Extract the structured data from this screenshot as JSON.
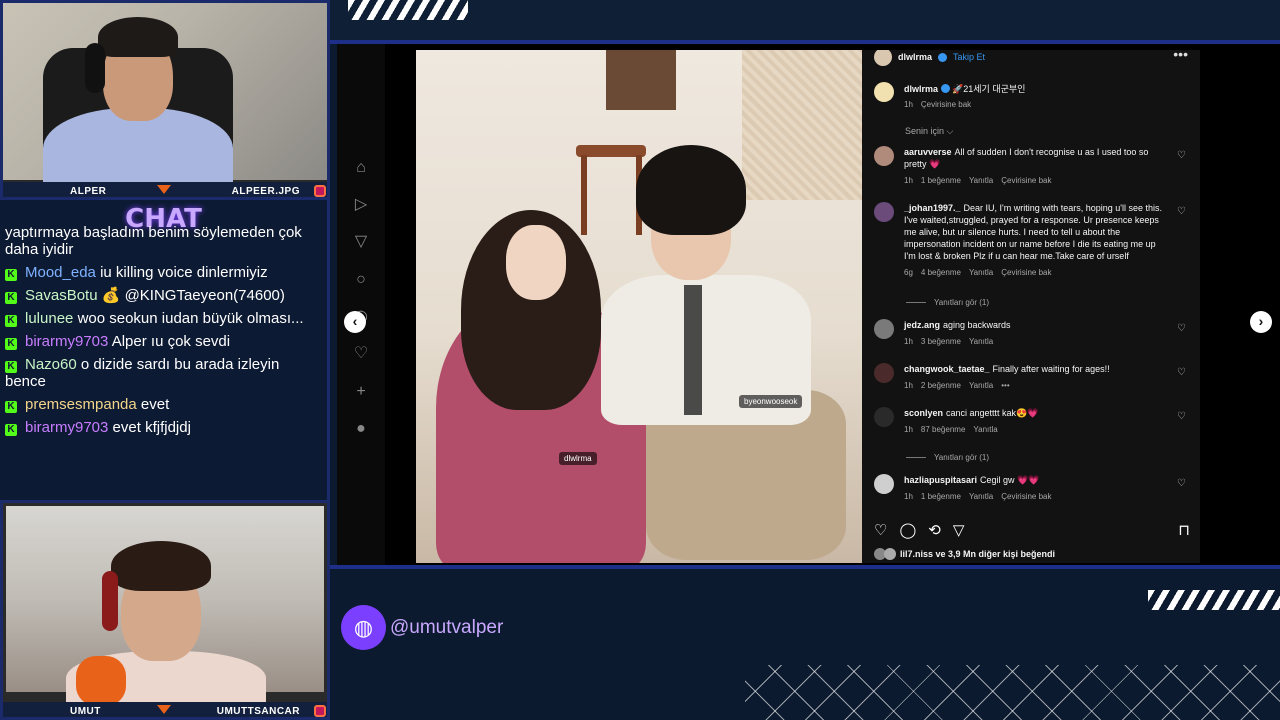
{
  "cam_top": {
    "left_name": "ALPER",
    "right_name": "ALPEER.JPG"
  },
  "cam_bottom": {
    "left_name": "UMUT",
    "right_name": "UMUTTSANCAR"
  },
  "chat": {
    "title": "CHAT",
    "continuation": "yaptırmaya başladım benim söylemeden çok daha iyidir",
    "messages": [
      {
        "user": "Mood_eda",
        "text": "iu killing voice dinlermiyiz",
        "color": "#7fb2ff"
      },
      {
        "user": "SavasBotu",
        "text": "💰 @KINGTaeyeon(74600)",
        "color": "#c8f5c8"
      },
      {
        "user": "lulunee",
        "text": "woo seokun iudan büyük olması...",
        "color": "#c8f5c8"
      },
      {
        "user": "birarmy9703",
        "text": "Alper ıu çok sevdi",
        "color": "#c77dff"
      },
      {
        "user": "Nazo60",
        "text": "o dizide sardı bu arada izleyin bence",
        "color": "#c8f5c8"
      },
      {
        "user": "premsesmpanda",
        "text": "evet",
        "color": "#f2d48a"
      },
      {
        "user": "birarmy9703",
        "text": "evet kfjfjdjdj",
        "color": "#c77dff"
      }
    ]
  },
  "post": {
    "header_user": "dlwlrma",
    "header_follow": "Takip Et",
    "caption_user": "dlwlrma",
    "caption_text": "🚀21세기 대군부인",
    "caption_time": "1h",
    "caption_translate": "Çevirisine bak",
    "for_you": "Senin için ⌵",
    "photo_tags": [
      "dlwlrma",
      "byeonwooseok"
    ],
    "comments": [
      {
        "user": "aaruvverse",
        "text": "All of sudden I don't recognise u as I used too so pretty 💗",
        "time": "1h",
        "likes": "1 beğenme",
        "reply": "Yanıtla",
        "translate": "Çevirisine bak"
      },
      {
        "user": "_johan1997._",
        "text": "Dear IU, I'm writing with tears, hoping u'll see this. I've waited,struggled, prayed for a response. Ur presence keeps me alive, but ur silence hurts. I need to tell u about the impersonation incident on ur name before I die its eating me up I'm lost & broken Plz if u can hear me.Take care of urself",
        "time": "6g",
        "likes": "4 beğenme",
        "reply": "Yanıtla",
        "translate": "Çevirisine bak",
        "replies": "Yanıtları gör (1)"
      },
      {
        "user": "jedz.ang",
        "text": "aging backwards",
        "time": "1h",
        "likes": "3 beğenme",
        "reply": "Yanıtla"
      },
      {
        "user": "changwook_taetae_",
        "text": "Finally after waiting for ages!!",
        "time": "1h",
        "likes": "2 beğenme",
        "reply": "Yanıtla",
        "more": "•••"
      },
      {
        "user": "sconlyen",
        "text": "canci angetttt kak😍💗",
        "time": "1h",
        "likes": "87 beğenme",
        "reply": "Yanıtla",
        "replies": "Yanıtları gör (1)"
      },
      {
        "user": "hazliapuspitasari",
        "text": "Cegil gw 💗💗",
        "time": "1h",
        "likes": "1 beğenme",
        "reply": "Yanıtla",
        "translate": "Çevirisine bak"
      }
    ],
    "likes_summary": "lil7.niss ve 3,9 Mn diğer kişi beğendi"
  },
  "handle": "@umutvalper",
  "colors": {
    "accent": "#7b3fff",
    "kick_green": "#53fc18",
    "frame_blue": "#1e2f8a"
  }
}
